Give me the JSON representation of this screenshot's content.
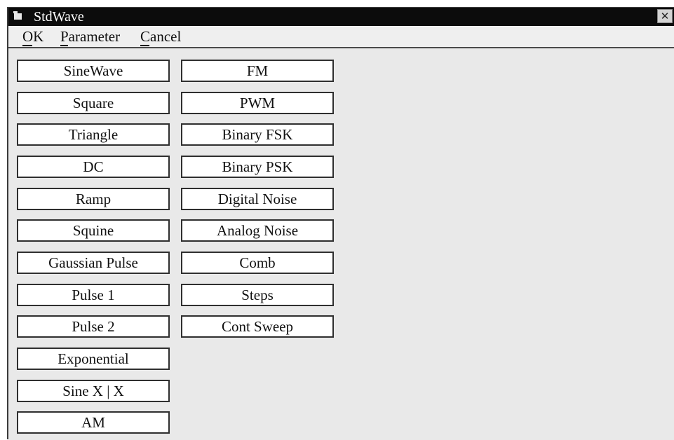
{
  "window": {
    "title": "StdWave",
    "close_glyph": "✕",
    "icon": "window-app-icon"
  },
  "menu": {
    "ok": "OK",
    "parameter": "Parameter",
    "cancel": "Cancel"
  },
  "buttons": {
    "column1": [
      "SineWave",
      "Square",
      "Triangle",
      "DC",
      "Ramp",
      "Squine",
      "Gaussian Pulse",
      "Pulse 1",
      "Pulse 2",
      "Exponential",
      "Sine X | X",
      "AM"
    ],
    "column2": [
      "FM",
      "PWM",
      "Binary FSK",
      "Binary PSK",
      "Digital Noise",
      "Analog Noise",
      "Comb",
      "Steps",
      "Cont Sweep"
    ]
  }
}
